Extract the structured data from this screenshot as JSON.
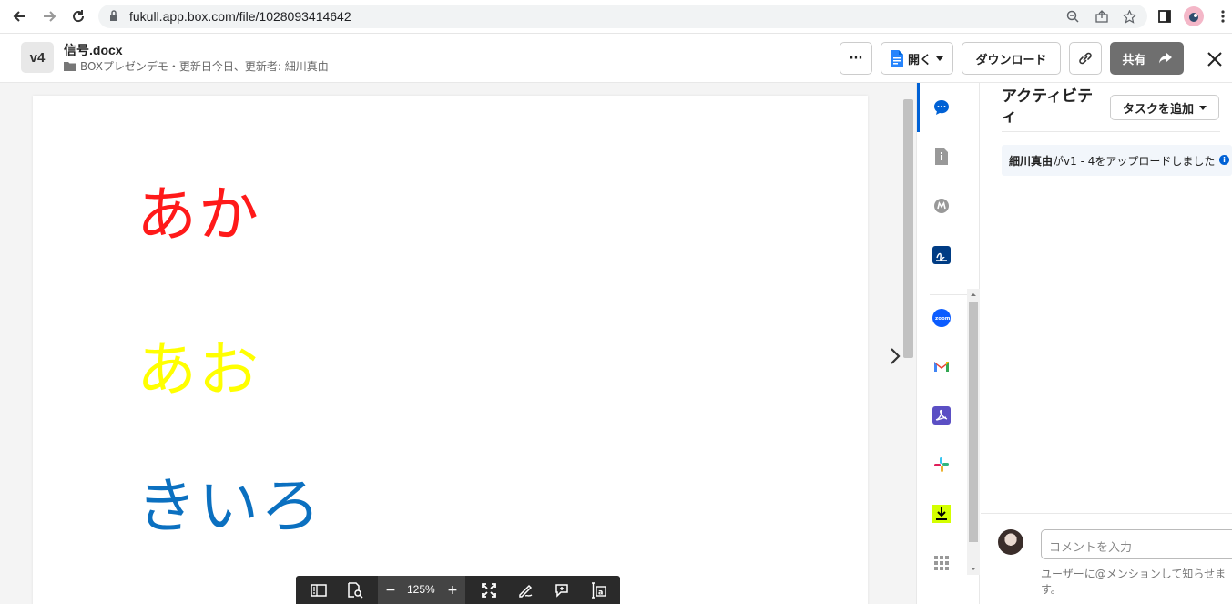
{
  "browser": {
    "url": "fukull.app.box.com/file/1028093414642"
  },
  "header": {
    "version": "v4",
    "file_name": "信号.docx",
    "meta": "BOXプレゼンデモ・更新日今日、更新者: 細川真由",
    "more_label": "···",
    "open_label": "開く",
    "download_label": "ダウンロード",
    "share_label": "共有"
  },
  "document": {
    "lines": [
      {
        "text": "あか",
        "color": "#ff1a1a"
      },
      {
        "text": "あお",
        "color": "#ffff00"
      },
      {
        "text": "きいろ",
        "color": "#0b70c0"
      }
    ]
  },
  "toolbar": {
    "zoom": "125%",
    "zoom_out": "−",
    "zoom_in": "+"
  },
  "sidebar": {
    "icons": [
      "comment-icon",
      "info-icon",
      "metadata-icon",
      "box-sign-icon",
      "zoom-icon",
      "gmail-icon",
      "adobe-icon",
      "slack-icon",
      "download-app-icon",
      "apps-grid-icon"
    ]
  },
  "activity": {
    "title": "アクティビティ",
    "add_task_label": "タスクを追加",
    "item": {
      "user": "細川真由",
      "action": "がv1 - 4をアップロードしました"
    },
    "comment_placeholder": "コメントを入力",
    "mention_hint": "ユーザーに@メンションして知らせます。"
  },
  "colors": {
    "accent": "#0061d5",
    "share_button": "#6f6f6f"
  }
}
